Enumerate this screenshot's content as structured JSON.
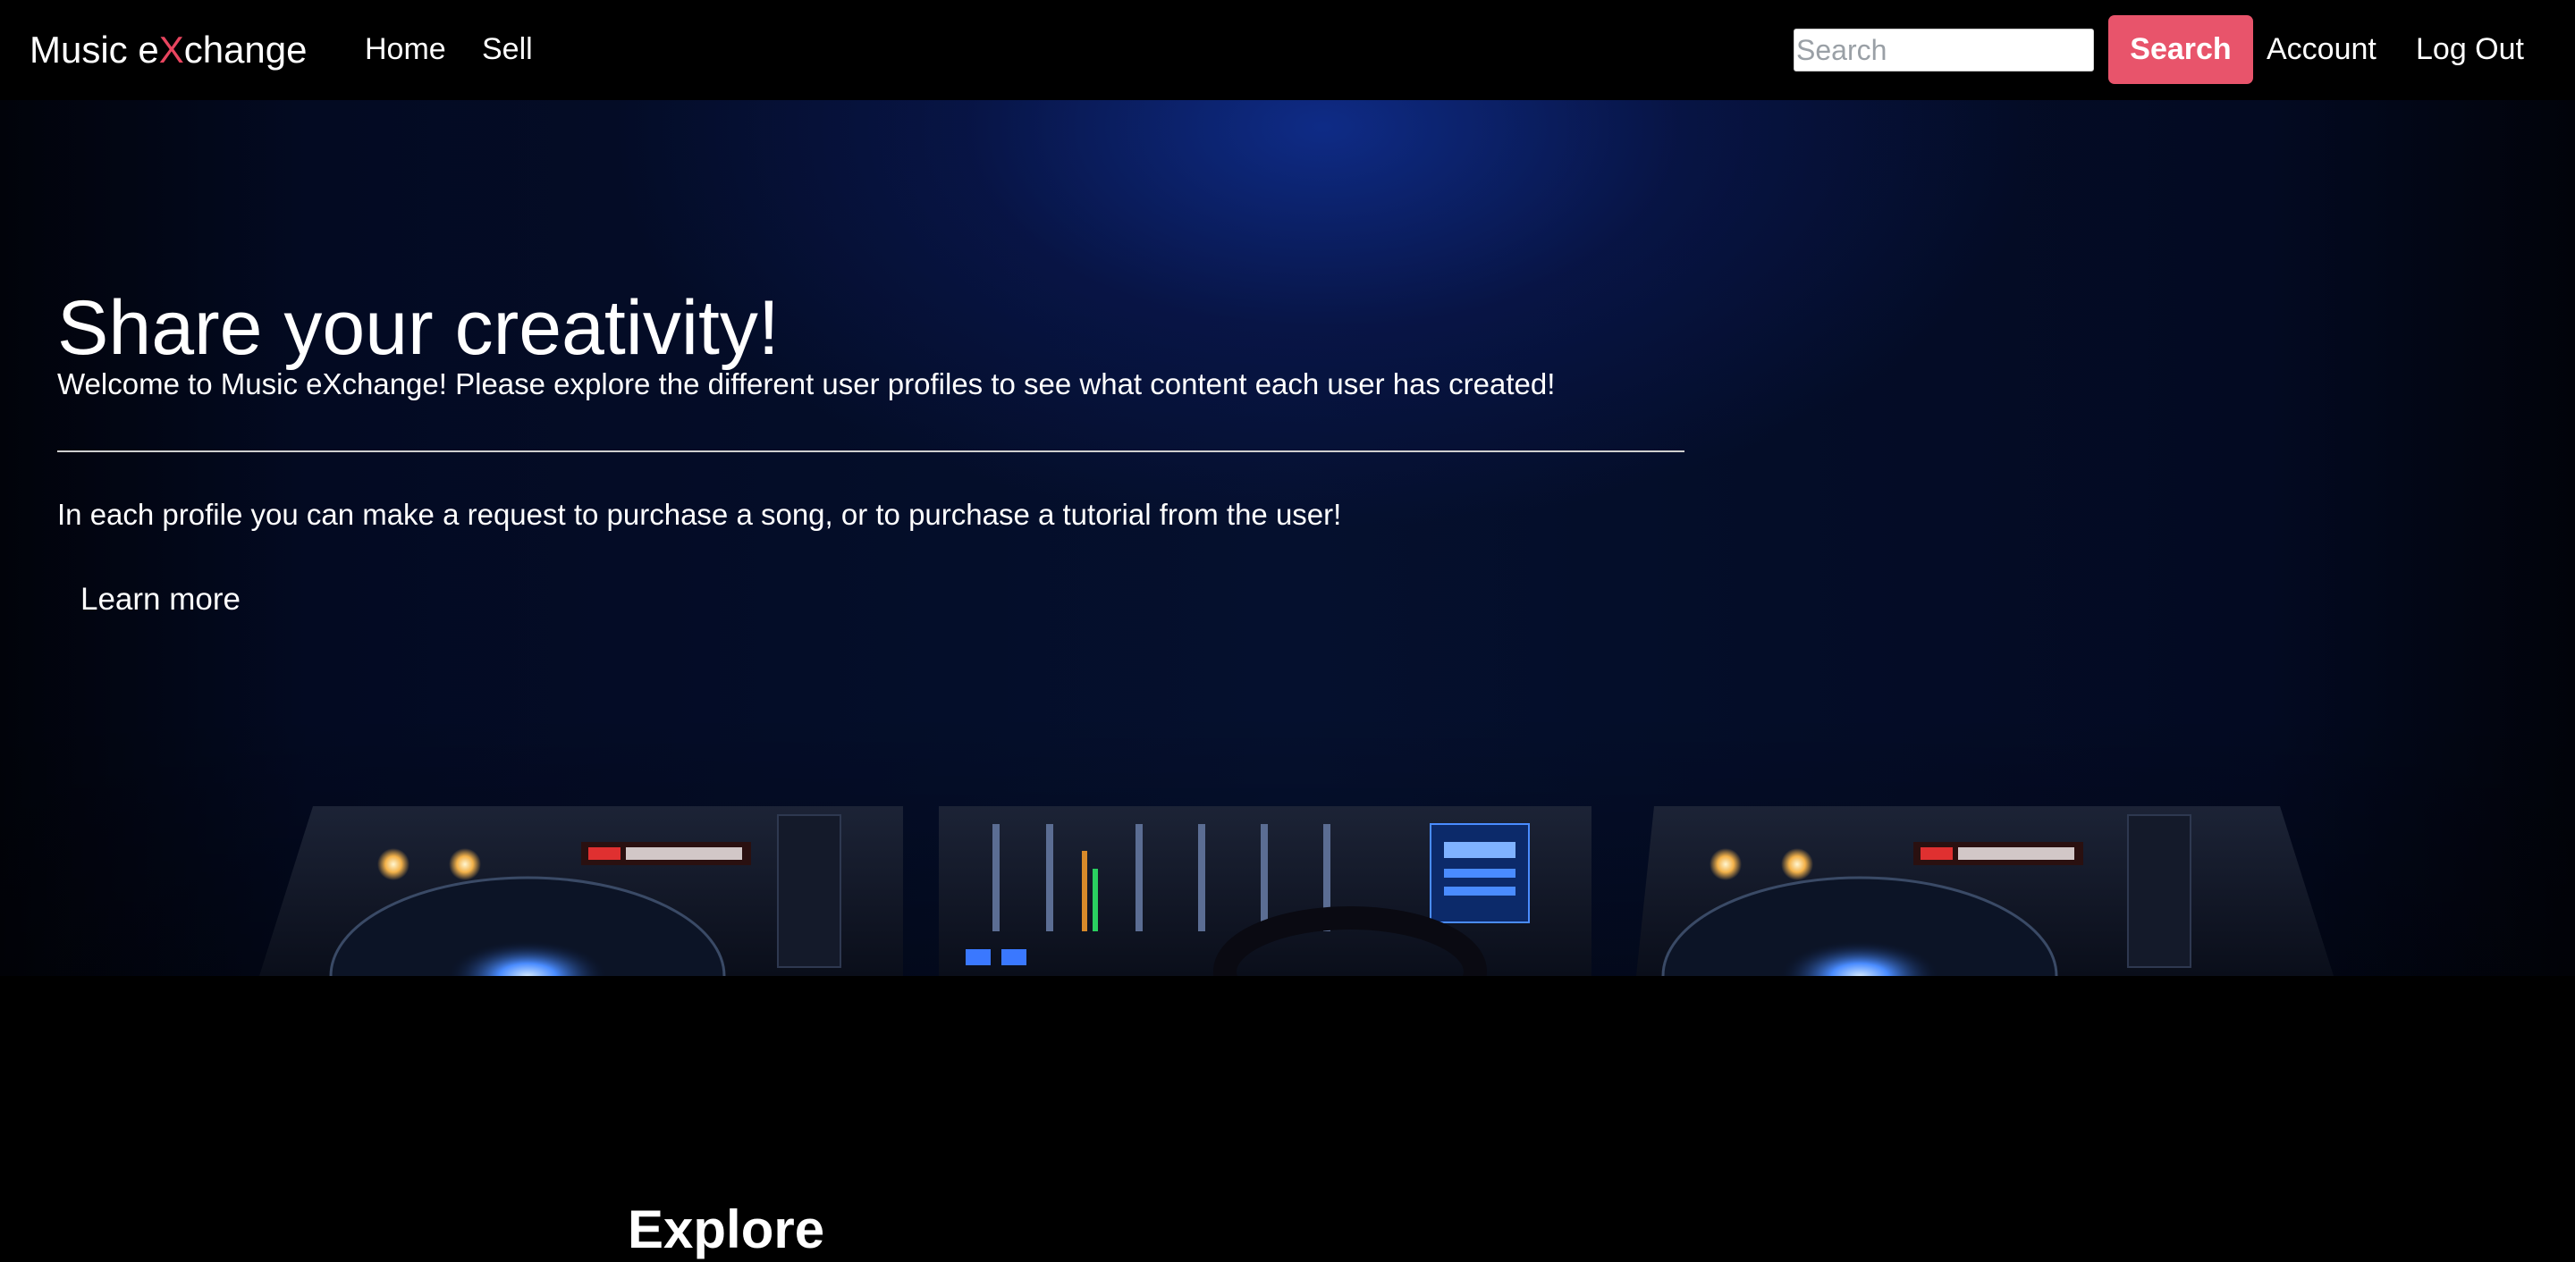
{
  "navbar": {
    "brand_prefix": "Music e",
    "brand_x": "X",
    "brand_suffix": "change",
    "links": {
      "home": "Home",
      "sell": "Sell",
      "account": "Account",
      "logout": "Log Out"
    },
    "search": {
      "placeholder": "Search",
      "value": "",
      "button_label": "Search"
    }
  },
  "hero": {
    "title": "Share your creativity!",
    "lead": "Welcome to Music eXchange! Please explore the different user profiles to see what content each user has created!",
    "text": "In each profile you can make a request to purchase a song, or to purchase a tutorial from the user!",
    "learn_more": "Learn more"
  },
  "explore": {
    "title": "Explore"
  },
  "colors": {
    "accent": "#e8546b",
    "brand_x": "#e8455f",
    "background": "#000000",
    "hero_blue": "#1030a0"
  }
}
